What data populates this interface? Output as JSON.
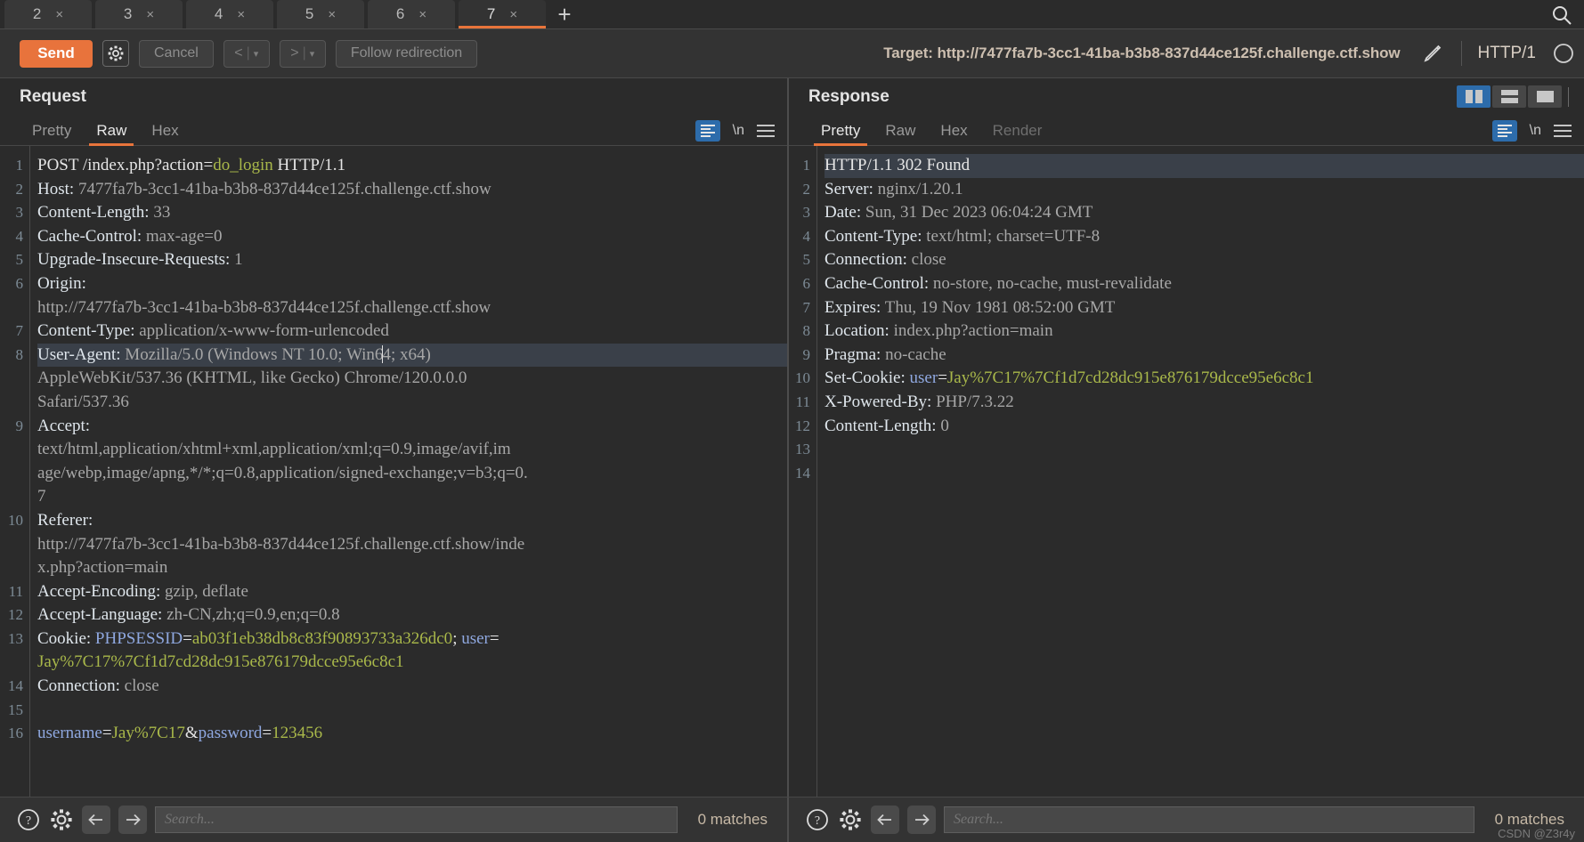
{
  "window": {
    "app": "Burp Suite Repeater",
    "watermark": "CSDN @Z3r4y"
  },
  "tabstrip": {
    "tabs": [
      {
        "label": "2",
        "close": "×",
        "active": false
      },
      {
        "label": "3",
        "close": "×",
        "active": false
      },
      {
        "label": "4",
        "close": "×",
        "active": false
      },
      {
        "label": "5",
        "close": "×",
        "active": false
      },
      {
        "label": "6",
        "close": "×",
        "active": false
      },
      {
        "label": "7",
        "close": "×",
        "active": true
      }
    ],
    "new_tab_label": "+",
    "search_icon": "search-icon"
  },
  "actionbar": {
    "send_label": "Send",
    "settings_icon": "gear-icon",
    "cancel_label": "Cancel",
    "prev_label": "<",
    "prev_carat": "▾",
    "next_label": ">",
    "next_carat": "▾",
    "follow_redirection_label": "Follow redirection",
    "target_label": "Target: http://7477fa7b-3cc1-41ba-b3b8-837d44ce125f.challenge.ctf.show",
    "edit_icon": "pencil-icon",
    "protocol_label": "HTTP/1",
    "help_icon": "help-circle-icon"
  },
  "request": {
    "title": "Request",
    "tabs": [
      {
        "label": "Pretty",
        "active": false,
        "disabled": false
      },
      {
        "label": "Raw",
        "active": true,
        "disabled": false
      },
      {
        "label": "Hex",
        "active": false,
        "disabled": false
      }
    ],
    "format_icon": "format-lines-icon",
    "newline_label": "\\n",
    "menu_icon": "hamburger-icon",
    "gutter": [
      "1",
      "2",
      "3",
      "4",
      "5",
      "",
      "6",
      "7",
      "8",
      "",
      "",
      "9",
      "",
      "",
      "",
      "10",
      "",
      "",
      "11",
      "12",
      "13",
      "",
      "14",
      "15",
      "16"
    ],
    "lines": [
      {
        "n": "1",
        "segments": [
          {
            "t": "POST /index.php?action=",
            "c": "white"
          },
          {
            "t": "do_login",
            "c": "green"
          },
          {
            "t": " HTTP/1.1",
            "c": "white"
          }
        ]
      },
      {
        "n": "2",
        "segments": [
          {
            "t": "Host: ",
            "c": "hname"
          },
          {
            "t": "7477fa7b-3cc1-41ba-b3b8-837d44ce125f.challenge.ctf.show",
            "c": "hval"
          }
        ]
      },
      {
        "n": "3",
        "segments": [
          {
            "t": "Content-Length: ",
            "c": "hname"
          },
          {
            "t": "33",
            "c": "hval"
          }
        ]
      },
      {
        "n": "4",
        "segments": [
          {
            "t": "Cache-Control: ",
            "c": "hname"
          },
          {
            "t": "max-age=0",
            "c": "hval"
          }
        ]
      },
      {
        "n": "5",
        "segments": [
          {
            "t": "Upgrade-Insecure-Requests: ",
            "c": "hname"
          },
          {
            "t": "1",
            "c": "hval"
          }
        ]
      },
      {
        "n": "6",
        "segments": [
          {
            "t": "Origin:",
            "c": "hname"
          }
        ]
      },
      {
        "n": "",
        "segments": [
          {
            "t": "http://7477fa7b-3cc1-41ba-b3b8-837d44ce125f.challenge.ctf.show",
            "c": "hval"
          }
        ]
      },
      {
        "n": "7",
        "segments": [
          {
            "t": "Content-Type: ",
            "c": "hname"
          },
          {
            "t": "application/x-www-form-urlencoded",
            "c": "hval"
          }
        ]
      },
      {
        "n": "8",
        "highlight": true,
        "segments": [
          {
            "t": "User-Agent: ",
            "c": "hname"
          },
          {
            "t": "Mozilla/5.0 (Windows NT 10.0; Win6",
            "c": "hval"
          },
          {
            "t": "|caret|",
            "c": "caret"
          },
          {
            "t": "4; x64)",
            "c": "hval"
          }
        ]
      },
      {
        "n": "",
        "segments": [
          {
            "t": "AppleWebKit/537.36 (KHTML, like Gecko) Chrome/120.0.0.0",
            "c": "hval"
          }
        ]
      },
      {
        "n": "",
        "segments": [
          {
            "t": "Safari/537.36",
            "c": "hval"
          }
        ]
      },
      {
        "n": "9",
        "segments": [
          {
            "t": "Accept:",
            "c": "hname"
          }
        ]
      },
      {
        "n": "",
        "segments": [
          {
            "t": "text/html,application/xhtml+xml,application/xml;q=0.9,image/avif,im",
            "c": "hval"
          }
        ]
      },
      {
        "n": "",
        "segments": [
          {
            "t": "age/webp,image/apng,*/*;q=0.8,application/signed-exchange;v=b3;q=0.",
            "c": "hval"
          }
        ]
      },
      {
        "n": "",
        "segments": [
          {
            "t": "7",
            "c": "hval"
          }
        ]
      },
      {
        "n": "10",
        "segments": [
          {
            "t": "Referer:",
            "c": "hname"
          }
        ]
      },
      {
        "n": "",
        "segments": [
          {
            "t": "http://7477fa7b-3cc1-41ba-b3b8-837d44ce125f.challenge.ctf.show/inde",
            "c": "hval"
          }
        ]
      },
      {
        "n": "",
        "segments": [
          {
            "t": "x.php?action=main",
            "c": "hval"
          }
        ]
      },
      {
        "n": "11",
        "segments": [
          {
            "t": "Accept-Encoding: ",
            "c": "hname"
          },
          {
            "t": "gzip, deflate",
            "c": "hval"
          }
        ]
      },
      {
        "n": "12",
        "segments": [
          {
            "t": "Accept-Language: ",
            "c": "hname"
          },
          {
            "t": "zh-CN,zh;q=0.9,en;q=0.8",
            "c": "hval"
          }
        ]
      },
      {
        "n": "13",
        "segments": [
          {
            "t": "Cookie: ",
            "c": "hname"
          },
          {
            "t": "PHPSESSID",
            "c": "blue"
          },
          {
            "t": "=",
            "c": "white"
          },
          {
            "t": "ab03f1eb38db8c83f90893733a326dc0",
            "c": "green"
          },
          {
            "t": "; ",
            "c": "white"
          },
          {
            "t": "user",
            "c": "blue"
          },
          {
            "t": "=",
            "c": "white"
          }
        ]
      },
      {
        "n": "",
        "segments": [
          {
            "t": "Jay%7C17%7Cf1d7cd28dc915e876179dcce95e6c8c1",
            "c": "green"
          }
        ]
      },
      {
        "n": "14",
        "segments": [
          {
            "t": "Connection: ",
            "c": "hname"
          },
          {
            "t": "close",
            "c": "hval"
          }
        ]
      },
      {
        "n": "15",
        "segments": [
          {
            "t": "",
            "c": "hval"
          }
        ]
      },
      {
        "n": "16",
        "segments": [
          {
            "t": "username",
            "c": "blue"
          },
          {
            "t": "=",
            "c": "white"
          },
          {
            "t": "Jay%7C17",
            "c": "green"
          },
          {
            "t": "&",
            "c": "white"
          },
          {
            "t": "password",
            "c": "blue"
          },
          {
            "t": "=",
            "c": "white"
          },
          {
            "t": "123456",
            "c": "green"
          }
        ]
      }
    ],
    "footer": {
      "help_icon": "help-circle-icon",
      "settings_icon": "gear-icon",
      "back_icon": "arrow-left-icon",
      "forward_icon": "arrow-right-icon",
      "search_placeholder": "Search...",
      "matches_label": "0 matches"
    }
  },
  "response": {
    "title": "Response",
    "viewmodes": [
      {
        "name": "side-by-side-view",
        "active": true
      },
      {
        "name": "stacked-view",
        "active": false
      },
      {
        "name": "single-view",
        "active": false
      }
    ],
    "tabs": [
      {
        "label": "Pretty",
        "active": true,
        "disabled": false
      },
      {
        "label": "Raw",
        "active": false,
        "disabled": false
      },
      {
        "label": "Hex",
        "active": false,
        "disabled": false
      },
      {
        "label": "Render",
        "active": false,
        "disabled": true
      }
    ],
    "format_icon": "format-lines-icon",
    "newline_label": "\\n",
    "menu_icon": "hamburger-icon",
    "lines": [
      {
        "n": "1",
        "highlight": true,
        "segments": [
          {
            "t": "HTTP/1.1 302 Found",
            "c": "white"
          }
        ]
      },
      {
        "n": "2",
        "segments": [
          {
            "t": "Server: ",
            "c": "hname"
          },
          {
            "t": "nginx/1.20.1",
            "c": "hval"
          }
        ]
      },
      {
        "n": "3",
        "segments": [
          {
            "t": "Date: ",
            "c": "hname"
          },
          {
            "t": "Sun, 31 Dec 2023 06:04:24 GMT",
            "c": "hval"
          }
        ]
      },
      {
        "n": "4",
        "segments": [
          {
            "t": "Content-Type: ",
            "c": "hname"
          },
          {
            "t": "text/html; charset=UTF-8",
            "c": "hval"
          }
        ]
      },
      {
        "n": "5",
        "segments": [
          {
            "t": "Connection: ",
            "c": "hname"
          },
          {
            "t": "close",
            "c": "hval"
          }
        ]
      },
      {
        "n": "6",
        "segments": [
          {
            "t": "Cache-Control: ",
            "c": "hname"
          },
          {
            "t": "no-store, no-cache, must-revalidate",
            "c": "hval"
          }
        ]
      },
      {
        "n": "7",
        "segments": [
          {
            "t": "Expires: ",
            "c": "hname"
          },
          {
            "t": "Thu, 19 Nov 1981 08:52:00 GMT",
            "c": "hval"
          }
        ]
      },
      {
        "n": "8",
        "segments": [
          {
            "t": "Location: ",
            "c": "hname"
          },
          {
            "t": "index.php?action=main",
            "c": "hval"
          }
        ]
      },
      {
        "n": "9",
        "segments": [
          {
            "t": "Pragma: ",
            "c": "hname"
          },
          {
            "t": "no-cache",
            "c": "hval"
          }
        ]
      },
      {
        "n": "10",
        "segments": [
          {
            "t": "Set-Cookie: ",
            "c": "hname"
          },
          {
            "t": "user",
            "c": "blue"
          },
          {
            "t": "=",
            "c": "white"
          },
          {
            "t": "Jay%7C17%7Cf1d7cd28dc915e876179dcce95e6c8c1",
            "c": "green"
          }
        ]
      },
      {
        "n": "11",
        "segments": [
          {
            "t": "X-Powered-By: ",
            "c": "hname"
          },
          {
            "t": "PHP/7.3.22",
            "c": "hval"
          }
        ]
      },
      {
        "n": "12",
        "segments": [
          {
            "t": "Content-Length: ",
            "c": "hname"
          },
          {
            "t": "0",
            "c": "hval"
          }
        ]
      },
      {
        "n": "13",
        "segments": [
          {
            "t": "",
            "c": "hval"
          }
        ]
      },
      {
        "n": "14",
        "segments": [
          {
            "t": "",
            "c": "hval"
          }
        ]
      }
    ],
    "footer": {
      "help_icon": "help-circle-icon",
      "settings_icon": "gear-icon",
      "back_icon": "arrow-left-icon",
      "forward_icon": "arrow-right-icon",
      "search_placeholder": "Search...",
      "matches_label": "0 matches"
    }
  },
  "colors": {
    "accent": "#e8743b",
    "selected_blue": "#2d6cab",
    "bg": "#2b2b2b",
    "panel": "#333333",
    "header_name": "#dfe6ec",
    "header_value": "#a7a7a7",
    "token_blue": "#8fa8e0",
    "token_green": "#a9b84a",
    "highlight_line": "#3a4049"
  }
}
